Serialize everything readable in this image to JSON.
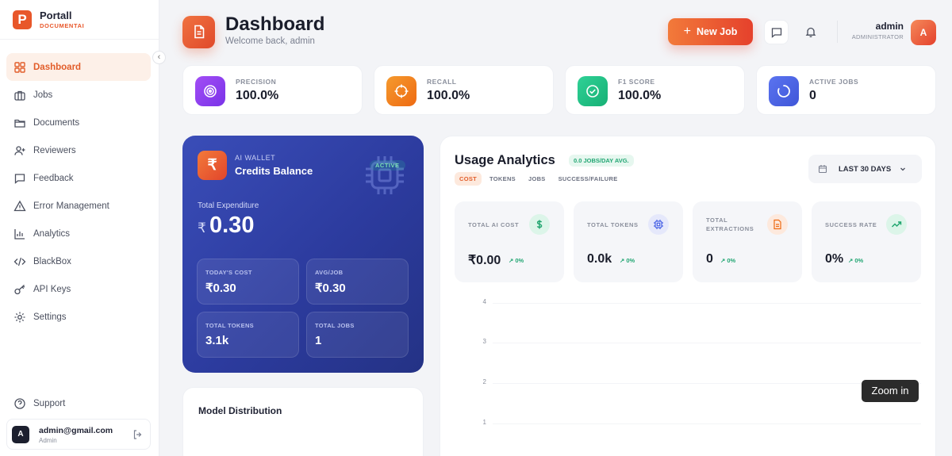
{
  "brand": {
    "name": "Portall",
    "sub": "DOCUMENTAI",
    "logo_letter": "P",
    "accent": "#e8572a"
  },
  "sidebar": {
    "items": [
      {
        "label": "Dashboard",
        "icon": "grid-icon"
      },
      {
        "label": "Jobs",
        "icon": "briefcase-icon"
      },
      {
        "label": "Documents",
        "icon": "folder-icon"
      },
      {
        "label": "Reviewers",
        "icon": "user-plus-icon"
      },
      {
        "label": "Feedback",
        "icon": "message-icon"
      },
      {
        "label": "Error Management",
        "icon": "warning-icon"
      },
      {
        "label": "Analytics",
        "icon": "bar-chart-icon"
      },
      {
        "label": "BlackBox",
        "icon": "code-icon"
      },
      {
        "label": "API Keys",
        "icon": "key-icon"
      },
      {
        "label": "Settings",
        "icon": "gear-icon"
      }
    ],
    "support": "Support",
    "user": {
      "initial": "A",
      "email": "admin@gmail.com",
      "role": "Admin"
    }
  },
  "header": {
    "title": "Dashboard",
    "subtitle": "Welcome back, admin",
    "new_job": "New Job",
    "user_name": "admin",
    "user_role": "ADMINISTRATOR",
    "user_initial": "A"
  },
  "stats": [
    {
      "label": "PRECISION",
      "value": "100.0%",
      "color": "#8b3ff0"
    },
    {
      "label": "RECALL",
      "value": "100.0%",
      "color": "#f07a1a"
    },
    {
      "label": "F1 SCORE",
      "value": "100.0%",
      "color": "#1fbf7f"
    },
    {
      "label": "ACTIVE JOBS",
      "value": "0",
      "color": "#4a63e6"
    }
  ],
  "wallet": {
    "kicker": "AI WALLET",
    "title": "Credits Balance",
    "status": "ACTIVE",
    "icon": "₹",
    "expenditure_label": "Total Expenditure",
    "currency": "₹",
    "amount": "0.30",
    "tiles": [
      {
        "label": "TODAY'S COST",
        "value": "₹0.30"
      },
      {
        "label": "AVG/JOB",
        "value": "₹0.30"
      },
      {
        "label": "TOTAL TOKENS",
        "value": "3.1k"
      },
      {
        "label": "TOTAL JOBS",
        "value": "1"
      }
    ]
  },
  "model_distribution": {
    "title": "Model Distribution"
  },
  "usage": {
    "title": "Usage Analytics",
    "badge": "0.0 JOBS/DAY AVG.",
    "tabs": [
      "COST",
      "TOKENS",
      "JOBS",
      "SUCCESS/FAILURE"
    ],
    "range": "LAST 30 DAYS",
    "metrics": [
      {
        "label": "TOTAL AI COST",
        "value": "₹0.00",
        "trend": "0%"
      },
      {
        "label": "TOTAL TOKENS",
        "value": "0.0k",
        "trend": "0%"
      },
      {
        "label": "TOTAL EXTRACTIONS",
        "value": "0",
        "trend": "0%"
      },
      {
        "label": "SUCCESS RATE",
        "value": "0%",
        "trend": "0%"
      }
    ],
    "y_ticks": [
      "4",
      "3",
      "2",
      "1"
    ]
  },
  "tooltip": "Zoom in"
}
